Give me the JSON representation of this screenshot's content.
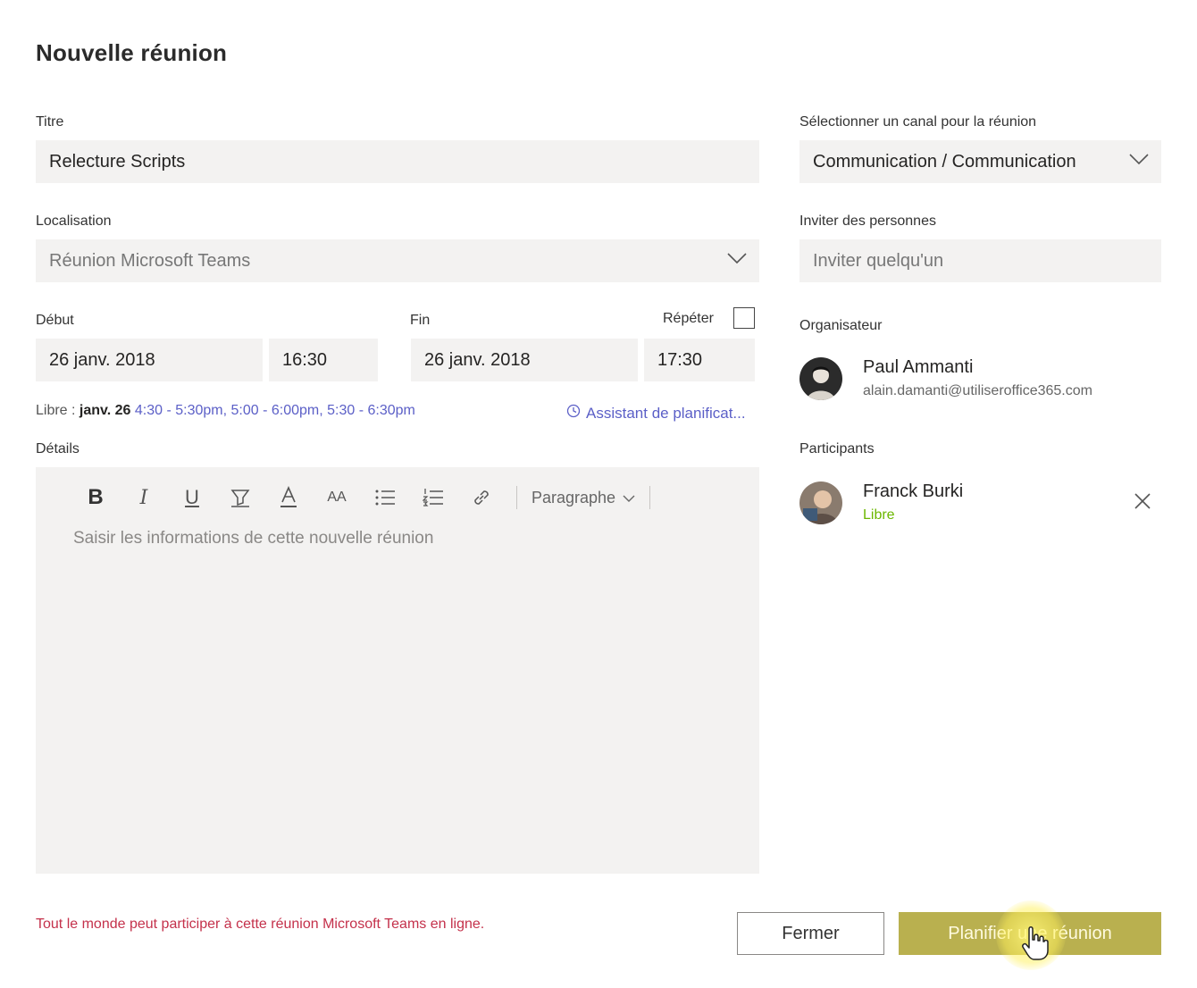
{
  "dialog": {
    "title": "Nouvelle réunion"
  },
  "form": {
    "title_label": "Titre",
    "title_value": "Relecture Scripts",
    "location_label": "Localisation",
    "location_value": "Réunion Microsoft Teams",
    "start_label": "Début",
    "start_date": "26 janv. 2018",
    "start_time": "16:30",
    "end_label": "Fin",
    "end_date": "26 janv. 2018",
    "end_time": "17:30",
    "repeat_label": "Répéter",
    "repeat_checked": false,
    "availability": {
      "prefix": "Libre :",
      "date": "janv. 26",
      "slots": [
        "4:30 - 5:30pm,",
        "5:00 - 6:00pm,",
        "5:30 - 6:30pm"
      ]
    },
    "assistant_link": "Assistant de planificat...",
    "details_label": "Détails",
    "details_placeholder": "Saisir les informations de cette nouvelle réunion",
    "toolbar": {
      "bold": "B",
      "italic": "I",
      "underline": "U",
      "font_size": "AA",
      "paragraph": "Paragraphe"
    }
  },
  "sidebar": {
    "channel_label": "Sélectionner un canal pour la réunion",
    "channel_value": "Communication / Communication",
    "invite_label": "Inviter des personnes",
    "invite_placeholder": "Inviter quelqu'un",
    "organizer_label": "Organisateur",
    "organizer": {
      "name": "Paul Ammanti",
      "email": "alain.damanti@utiliseroffice365.com"
    },
    "participants_label": "Participants",
    "participants": [
      {
        "name": "Franck Burki",
        "status": "Libre"
      }
    ]
  },
  "footer": {
    "notice": "Tout le monde peut participer à cette réunion Microsoft Teams en ligne.",
    "close_label": "Fermer",
    "schedule_label": "Planifier une réunion"
  },
  "colors": {
    "accent": "#5b5fc7",
    "status_free": "#6bb700",
    "notice": "#c4314b",
    "primary_button": "#b9b04f",
    "field_bg": "#f3f2f1"
  },
  "icons": [
    "chevron-down-icon",
    "bold-icon",
    "italic-icon",
    "underline-icon",
    "highlight-icon",
    "font-color-icon",
    "font-size-icon",
    "bullet-list-icon",
    "numbered-list-icon",
    "link-icon",
    "clock-icon",
    "close-icon",
    "hand-cursor-icon"
  ]
}
